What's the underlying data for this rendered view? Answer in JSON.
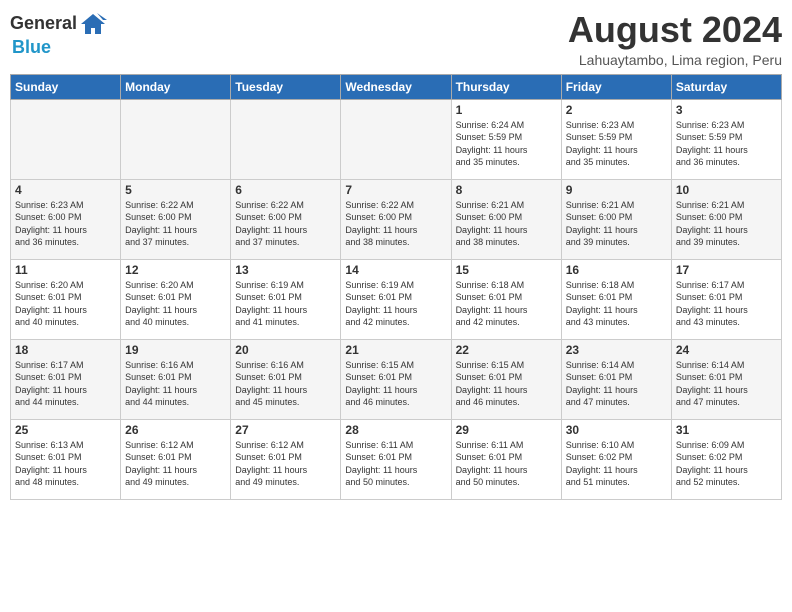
{
  "header": {
    "logo_general": "General",
    "logo_blue": "Blue",
    "title": "August 2024",
    "subtitle": "Lahuaytambo, Lima region, Peru"
  },
  "weekdays": [
    "Sunday",
    "Monday",
    "Tuesday",
    "Wednesday",
    "Thursday",
    "Friday",
    "Saturday"
  ],
  "weeks": [
    [
      {
        "num": "",
        "info": "",
        "empty": true
      },
      {
        "num": "",
        "info": "",
        "empty": true
      },
      {
        "num": "",
        "info": "",
        "empty": true
      },
      {
        "num": "",
        "info": "",
        "empty": true
      },
      {
        "num": "1",
        "info": "Sunrise: 6:24 AM\nSunset: 5:59 PM\nDaylight: 11 hours\nand 35 minutes."
      },
      {
        "num": "2",
        "info": "Sunrise: 6:23 AM\nSunset: 5:59 PM\nDaylight: 11 hours\nand 35 minutes."
      },
      {
        "num": "3",
        "info": "Sunrise: 6:23 AM\nSunset: 5:59 PM\nDaylight: 11 hours\nand 36 minutes."
      }
    ],
    [
      {
        "num": "4",
        "info": "Sunrise: 6:23 AM\nSunset: 6:00 PM\nDaylight: 11 hours\nand 36 minutes."
      },
      {
        "num": "5",
        "info": "Sunrise: 6:22 AM\nSunset: 6:00 PM\nDaylight: 11 hours\nand 37 minutes."
      },
      {
        "num": "6",
        "info": "Sunrise: 6:22 AM\nSunset: 6:00 PM\nDaylight: 11 hours\nand 37 minutes."
      },
      {
        "num": "7",
        "info": "Sunrise: 6:22 AM\nSunset: 6:00 PM\nDaylight: 11 hours\nand 38 minutes."
      },
      {
        "num": "8",
        "info": "Sunrise: 6:21 AM\nSunset: 6:00 PM\nDaylight: 11 hours\nand 38 minutes."
      },
      {
        "num": "9",
        "info": "Sunrise: 6:21 AM\nSunset: 6:00 PM\nDaylight: 11 hours\nand 39 minutes."
      },
      {
        "num": "10",
        "info": "Sunrise: 6:21 AM\nSunset: 6:00 PM\nDaylight: 11 hours\nand 39 minutes."
      }
    ],
    [
      {
        "num": "11",
        "info": "Sunrise: 6:20 AM\nSunset: 6:01 PM\nDaylight: 11 hours\nand 40 minutes."
      },
      {
        "num": "12",
        "info": "Sunrise: 6:20 AM\nSunset: 6:01 PM\nDaylight: 11 hours\nand 40 minutes."
      },
      {
        "num": "13",
        "info": "Sunrise: 6:19 AM\nSunset: 6:01 PM\nDaylight: 11 hours\nand 41 minutes."
      },
      {
        "num": "14",
        "info": "Sunrise: 6:19 AM\nSunset: 6:01 PM\nDaylight: 11 hours\nand 42 minutes."
      },
      {
        "num": "15",
        "info": "Sunrise: 6:18 AM\nSunset: 6:01 PM\nDaylight: 11 hours\nand 42 minutes."
      },
      {
        "num": "16",
        "info": "Sunrise: 6:18 AM\nSunset: 6:01 PM\nDaylight: 11 hours\nand 43 minutes."
      },
      {
        "num": "17",
        "info": "Sunrise: 6:17 AM\nSunset: 6:01 PM\nDaylight: 11 hours\nand 43 minutes."
      }
    ],
    [
      {
        "num": "18",
        "info": "Sunrise: 6:17 AM\nSunset: 6:01 PM\nDaylight: 11 hours\nand 44 minutes."
      },
      {
        "num": "19",
        "info": "Sunrise: 6:16 AM\nSunset: 6:01 PM\nDaylight: 11 hours\nand 44 minutes."
      },
      {
        "num": "20",
        "info": "Sunrise: 6:16 AM\nSunset: 6:01 PM\nDaylight: 11 hours\nand 45 minutes."
      },
      {
        "num": "21",
        "info": "Sunrise: 6:15 AM\nSunset: 6:01 PM\nDaylight: 11 hours\nand 46 minutes."
      },
      {
        "num": "22",
        "info": "Sunrise: 6:15 AM\nSunset: 6:01 PM\nDaylight: 11 hours\nand 46 minutes."
      },
      {
        "num": "23",
        "info": "Sunrise: 6:14 AM\nSunset: 6:01 PM\nDaylight: 11 hours\nand 47 minutes."
      },
      {
        "num": "24",
        "info": "Sunrise: 6:14 AM\nSunset: 6:01 PM\nDaylight: 11 hours\nand 47 minutes."
      }
    ],
    [
      {
        "num": "25",
        "info": "Sunrise: 6:13 AM\nSunset: 6:01 PM\nDaylight: 11 hours\nand 48 minutes."
      },
      {
        "num": "26",
        "info": "Sunrise: 6:12 AM\nSunset: 6:01 PM\nDaylight: 11 hours\nand 49 minutes."
      },
      {
        "num": "27",
        "info": "Sunrise: 6:12 AM\nSunset: 6:01 PM\nDaylight: 11 hours\nand 49 minutes."
      },
      {
        "num": "28",
        "info": "Sunrise: 6:11 AM\nSunset: 6:01 PM\nDaylight: 11 hours\nand 50 minutes."
      },
      {
        "num": "29",
        "info": "Sunrise: 6:11 AM\nSunset: 6:01 PM\nDaylight: 11 hours\nand 50 minutes."
      },
      {
        "num": "30",
        "info": "Sunrise: 6:10 AM\nSunset: 6:02 PM\nDaylight: 11 hours\nand 51 minutes."
      },
      {
        "num": "31",
        "info": "Sunrise: 6:09 AM\nSunset: 6:02 PM\nDaylight: 11 hours\nand 52 minutes."
      }
    ]
  ]
}
